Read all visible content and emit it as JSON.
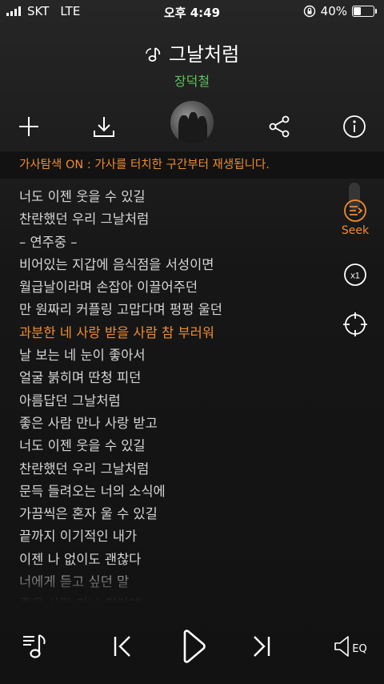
{
  "status_bar": {
    "carrier": "SKT",
    "network": "LTE",
    "time": "오후 4:49",
    "battery_percent": "40%",
    "battery_level": 0.4
  },
  "song": {
    "title": "그날처럼",
    "artist": "장덕철"
  },
  "toolbar": {
    "icons": [
      "plus-icon",
      "download-icon",
      "album-art",
      "share-icon",
      "info-icon"
    ]
  },
  "info_banner": "가사탐색 ON : 가사를 터치한 구간부터 재생됩니다.",
  "lyrics": [
    {
      "text": "너도 이젠 웃을 수 있길",
      "active": false
    },
    {
      "text": "찬란했던 우리 그날처럼",
      "active": false
    },
    {
      "text": " – 연주중 –",
      "active": false
    },
    {
      "text": "비어있는 지갑에 음식점을 서성이면",
      "active": false
    },
    {
      "text": "월급날이라며 손잡아 이끌어주던",
      "active": false
    },
    {
      "text": "만 원짜리 커플링 고맙다며 펑펑 울던",
      "active": false
    },
    {
      "text": "과분한 네 사랑 받을 사람 참 부러워",
      "active": true
    },
    {
      "text": "날 보는 네 눈이 좋아서",
      "active": false
    },
    {
      "text": "얼굴 붉히며 딴청 피던",
      "active": false
    },
    {
      "text": "아름답던 그날처럼",
      "active": false
    },
    {
      "text": "좋은 사람 만나 사랑 받고",
      "active": false
    },
    {
      "text": "너도 이젠 웃을 수 있길",
      "active": false
    },
    {
      "text": "찬란했던 우리 그날처럼",
      "active": false
    },
    {
      "text": "문득 들려오는 너의 소식에",
      "active": false
    },
    {
      "text": "가끔씩은 혼자 울 수 있길",
      "active": false
    },
    {
      "text": "끝까지 이기적인 내가",
      "active": false
    },
    {
      "text": "이젠 나 없이도 괜찮다",
      "active": false
    },
    {
      "text": "너에게 듣고 싶던 말",
      "active": false
    },
    {
      "text": "좋은 사람 만나 미안해",
      "active": false
    }
  ],
  "side_controls": {
    "seek_label": "Seek",
    "speed_label": "x1"
  },
  "bottom_controls": {
    "eq_label": "EQ"
  },
  "colors": {
    "accent": "#f08c2e",
    "artist": "#5ac45a",
    "lyric_text": "#d6d6d6"
  }
}
